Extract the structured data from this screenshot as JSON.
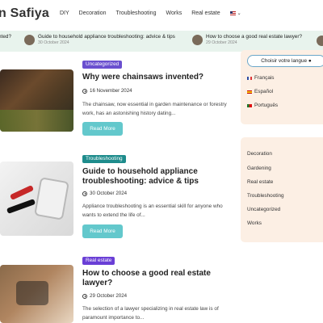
{
  "header": {
    "logo": "n Safiya",
    "nav": [
      "DIY",
      "Decoration",
      "Troubleshooting",
      "Works",
      "Real estate"
    ]
  },
  "ticker": [
    {
      "title": "nted?",
      "date": ""
    },
    {
      "title": "Guide to household appliance troubleshooting: advice & tips",
      "date": "30 October 2024"
    },
    {
      "title": "How to choose a good real estate lawyer?",
      "date": "29 October 2024"
    }
  ],
  "articles": [
    {
      "category": "Uncategorized",
      "title": "Why were chainsaws invented?",
      "date": "16 November 2024",
      "excerpt": "The chainsaw, now essential in garden maintenance or forestry work, has an astonishing history dating...",
      "button": "Read More"
    },
    {
      "category": "Troubleshooting",
      "title": "Guide to household appliance troubleshooting: advice & tips",
      "date": "30 October 2024",
      "excerpt": "Appliance troubleshooting is an essential skill for anyone who wants to extend the life of...",
      "button": "Read More"
    },
    {
      "category": "Real estate",
      "title": "How to choose a good real estate lawyer?",
      "date": "29 October 2024",
      "excerpt": "The selection of a lawyer specializing in real estate law is of paramount importance to...",
      "button": ""
    }
  ],
  "sidebar": {
    "language_button": "Choisir votre langue",
    "languages": [
      "Français",
      "Español",
      "Português"
    ],
    "categories": [
      "Decoration",
      "Gardening",
      "Real estate",
      "Troubleshooting",
      "Uncategorized",
      "Works"
    ]
  },
  "colors": {
    "badge_uncategorized": "#6a4fcf",
    "badge_troubleshooting": "#1e8c8c",
    "badge_real_estate": "#6a3fd6",
    "read_more": "#63c8cc",
    "sidebar_bg": "#fcefe4",
    "ticker_bg": "#e8f3ed"
  },
  "icons": [
    "clock-icon",
    "chevron-down-icon",
    "us-flag-icon",
    "fr-flag-icon",
    "es-flag-icon",
    "pt-flag-icon",
    "globe-icon"
  ]
}
